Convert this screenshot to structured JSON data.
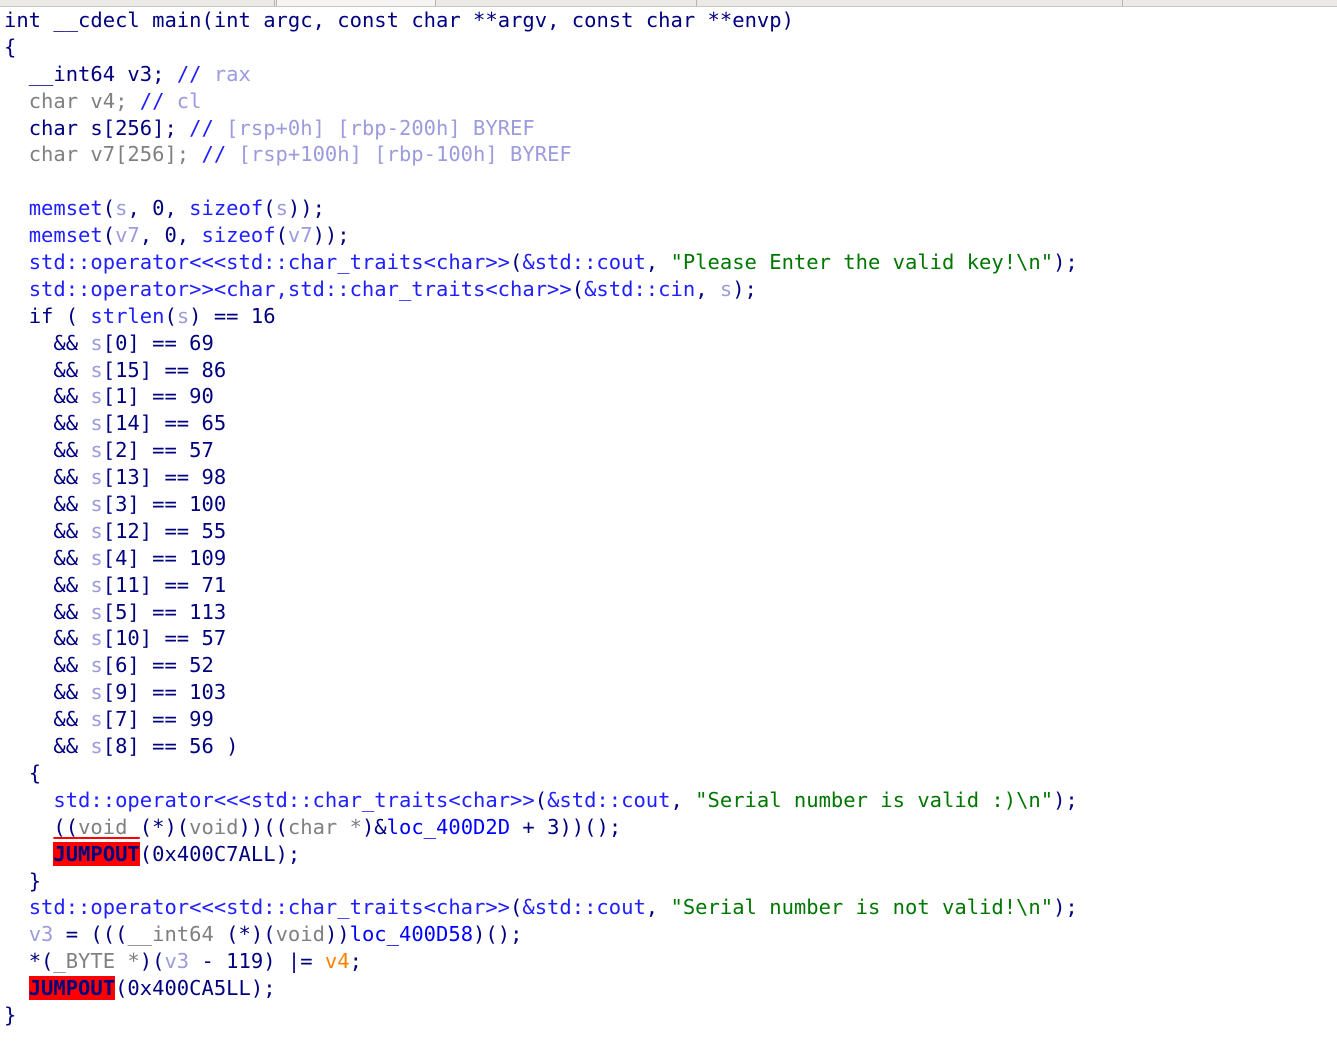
{
  "window": {
    "kind": "hex-rays-pseudocode-view",
    "tab_bar_visible": true
  },
  "code": {
    "language": "c-pseudocode",
    "lines": [
      {
        "id": "l1",
        "indent": 0,
        "text": "int __cdecl main(int argc, const char **argv, const char **envp)"
      },
      {
        "id": "l2",
        "indent": 0,
        "text": "{"
      },
      {
        "id": "l3",
        "indent": 1,
        "text": "__int64 v3; // rax"
      },
      {
        "id": "l4",
        "indent": 1,
        "text": "char v4; // cl"
      },
      {
        "id": "l5",
        "indent": 1,
        "text": "char s[256]; // [rsp+0h] [rbp-200h] BYREF"
      },
      {
        "id": "l6",
        "indent": 1,
        "text": "char v7[256]; // [rsp+100h] [rbp-100h] BYREF"
      },
      {
        "id": "l7",
        "indent": 0,
        "text": ""
      },
      {
        "id": "l8",
        "indent": 1,
        "text": "memset(s, 0, sizeof(s));"
      },
      {
        "id": "l9",
        "indent": 1,
        "text": "memset(v7, 0, sizeof(v7));"
      },
      {
        "id": "l10",
        "indent": 1,
        "text": "std::operator<<<std::char_traits<char>>(&std::cout, \"Please Enter the valid key!\\n\");"
      },
      {
        "id": "l11",
        "indent": 1,
        "text": "std::operator>><char,std::char_traits<char>>(&std::cin, s);"
      },
      {
        "id": "l12",
        "indent": 1,
        "text": "if ( strlen(s) == 16"
      },
      {
        "id": "l13",
        "indent": 2,
        "text": "&& s[0] == 69"
      },
      {
        "id": "l14",
        "indent": 2,
        "text": "&& s[15] == 86"
      },
      {
        "id": "l15",
        "indent": 2,
        "text": "&& s[1] == 90"
      },
      {
        "id": "l16",
        "indent": 2,
        "text": "&& s[14] == 65"
      },
      {
        "id": "l17",
        "indent": 2,
        "text": "&& s[2] == 57"
      },
      {
        "id": "l18",
        "indent": 2,
        "text": "&& s[13] == 98"
      },
      {
        "id": "l19",
        "indent": 2,
        "text": "&& s[3] == 100"
      },
      {
        "id": "l20",
        "indent": 2,
        "text": "&& s[12] == 55"
      },
      {
        "id": "l21",
        "indent": 2,
        "text": "&& s[4] == 109"
      },
      {
        "id": "l22",
        "indent": 2,
        "text": "&& s[11] == 71"
      },
      {
        "id": "l23",
        "indent": 2,
        "text": "&& s[5] == 113"
      },
      {
        "id": "l24",
        "indent": 2,
        "text": "&& s[10] == 57"
      },
      {
        "id": "l25",
        "indent": 2,
        "text": "&& s[6] == 52"
      },
      {
        "id": "l26",
        "indent": 2,
        "text": "&& s[9] == 103"
      },
      {
        "id": "l27",
        "indent": 2,
        "text": "&& s[7] == 99"
      },
      {
        "id": "l28",
        "indent": 2,
        "text": "&& s[8] == 56 )"
      },
      {
        "id": "l29",
        "indent": 1,
        "text": "{"
      },
      {
        "id": "l30",
        "indent": 2,
        "text": "std::operator<<<std::char_traits<char>>(&std::cout, \"Serial number is valid :)\\n\");"
      },
      {
        "id": "l31",
        "indent": 2,
        "text": "((void (*)(void))((char *)&loc_400D2D + 3))();"
      },
      {
        "id": "l32",
        "indent": 2,
        "text": "JUMPOUT(0x400C7ALL);"
      },
      {
        "id": "l33",
        "indent": 1,
        "text": "}"
      },
      {
        "id": "l34",
        "indent": 1,
        "text": "std::operator<<<std::char_traits<char>>(&std::cout, \"Serial number is not valid!\\n\");"
      },
      {
        "id": "l35",
        "indent": 1,
        "text": "v3 = ((__int64 (*)(void))loc_400D58)();"
      },
      {
        "id": "l36",
        "indent": 1,
        "text": "*(_BYTE *)(v3 - 119) |= v4;"
      },
      {
        "id": "l37",
        "indent": 1,
        "text": "JUMPOUT(0x400CA5LL);"
      },
      {
        "id": "l38",
        "indent": 0,
        "text": "}"
      }
    ],
    "signature": {
      "return_type": "int",
      "calling_convention": "__cdecl",
      "name": "main",
      "params": [
        "int argc",
        "const char **argv",
        "const char **envp"
      ]
    },
    "locals": [
      {
        "type": "__int64",
        "name": "v3",
        "comment": "rax"
      },
      {
        "type": "char",
        "name": "v4",
        "comment": "cl"
      },
      {
        "type": "char",
        "name": "s[256]",
        "comment": "[rsp+0h] [rbp-200h] BYREF"
      },
      {
        "type": "char",
        "name": "v7[256]",
        "comment": "[rsp+100h] [rbp-100h] BYREF"
      }
    ],
    "strings": [
      "Please Enter the valid key!\\n",
      "Serial number is valid :)\\n",
      "Serial number is not valid!\\n"
    ],
    "key_checks": {
      "length": 16,
      "constraints": [
        {
          "index": 0,
          "value": 69
        },
        {
          "index": 15,
          "value": 86
        },
        {
          "index": 1,
          "value": 90
        },
        {
          "index": 14,
          "value": 65
        },
        {
          "index": 2,
          "value": 57
        },
        {
          "index": 13,
          "value": 98
        },
        {
          "index": 3,
          "value": 100
        },
        {
          "index": 12,
          "value": 55
        },
        {
          "index": 4,
          "value": 109
        },
        {
          "index": 11,
          "value": 71
        },
        {
          "index": 5,
          "value": 113
        },
        {
          "index": 10,
          "value": 57
        },
        {
          "index": 6,
          "value": 52
        },
        {
          "index": 9,
          "value": 103
        },
        {
          "index": 7,
          "value": 99
        },
        {
          "index": 8,
          "value": 56
        }
      ]
    },
    "jumpouts": [
      "0x400C7ALL",
      "0x400CA5LL"
    ],
    "labels": [
      "loc_400D2D",
      "loc_400D58"
    ]
  },
  "tokens": {
    "l1": [
      {
        "t": "int",
        "c": "kw"
      },
      {
        "t": " ",
        "c": "kw"
      },
      {
        "t": "__cdecl",
        "c": "kw"
      },
      {
        "t": " ",
        "c": "kw"
      },
      {
        "t": "main",
        "c": "kw"
      },
      {
        "t": "(",
        "c": "kw"
      },
      {
        "t": "int",
        "c": "kw"
      },
      {
        "t": " argc, ",
        "c": "kw"
      },
      {
        "t": "const char **argv, const char **envp)",
        "c": "kw"
      }
    ],
    "l3": [
      {
        "t": "__int64",
        "c": "kw"
      },
      {
        "t": " v3; ",
        "c": "kw"
      },
      {
        "t": "//",
        "c": "cmtslash"
      },
      {
        "t": " rax",
        "c": "cmt"
      }
    ],
    "l4": [
      {
        "t": "char",
        "c": "kwg"
      },
      {
        "t": " v4; ",
        "c": "kwg"
      },
      {
        "t": "//",
        "c": "cmtslash"
      },
      {
        "t": " cl",
        "c": "cmt"
      }
    ],
    "l5": [
      {
        "t": "char",
        "c": "kw"
      },
      {
        "t": " s[256]; ",
        "c": "kw"
      },
      {
        "t": "//",
        "c": "cmtslash"
      },
      {
        "t": " [rsp+0h] [rbp-200h] BYREF",
        "c": "cmt"
      }
    ],
    "l6": [
      {
        "t": "char",
        "c": "kwg"
      },
      {
        "t": " v7[256]; ",
        "c": "kwg"
      },
      {
        "t": "//",
        "c": "cmtslash"
      },
      {
        "t": " [rsp+100h] [rbp-100h] BYREF",
        "c": "cmt"
      }
    ],
    "l8": [
      {
        "t": "memset",
        "c": "fn"
      },
      {
        "t": "(",
        "c": "kw"
      },
      {
        "t": "s",
        "c": "var"
      },
      {
        "t": ", 0, ",
        "c": "kw"
      },
      {
        "t": "sizeof",
        "c": "fn"
      },
      {
        "t": "(",
        "c": "kw"
      },
      {
        "t": "s",
        "c": "var"
      },
      {
        "t": "));",
        "c": "kw"
      }
    ],
    "l9": [
      {
        "t": "memset",
        "c": "fn"
      },
      {
        "t": "(",
        "c": "kw"
      },
      {
        "t": "v7",
        "c": "var"
      },
      {
        "t": ", 0, ",
        "c": "kw"
      },
      {
        "t": "sizeof",
        "c": "fn"
      },
      {
        "t": "(",
        "c": "kw"
      },
      {
        "t": "v7",
        "c": "var"
      },
      {
        "t": "));",
        "c": "kw"
      }
    ],
    "l10": [
      {
        "t": "std::operator<<<std::char_traits<char>>",
        "c": "fn"
      },
      {
        "t": "(",
        "c": "kw"
      },
      {
        "t": "&std::cout",
        "c": "fn"
      },
      {
        "t": ", ",
        "c": "kw"
      },
      {
        "t": "\"Please Enter the valid key!\\n\"",
        "c": "str"
      },
      {
        "t": ");",
        "c": "kw"
      }
    ],
    "l11": [
      {
        "t": "std::operator>><char,std::char_traits<char>>",
        "c": "fn"
      },
      {
        "t": "(",
        "c": "kw"
      },
      {
        "t": "&std::cin",
        "c": "fn"
      },
      {
        "t": ", ",
        "c": "kw"
      },
      {
        "t": "s",
        "c": "var"
      },
      {
        "t": ");",
        "c": "kw"
      }
    ],
    "l12": [
      {
        "t": "if",
        "c": "kw"
      },
      {
        "t": " ( ",
        "c": "kw"
      },
      {
        "t": "strlen",
        "c": "fn"
      },
      {
        "t": "(",
        "c": "kw"
      },
      {
        "t": "s",
        "c": "var"
      },
      {
        "t": ") == 16",
        "c": "kw"
      }
    ],
    "l30": [
      {
        "t": "std::operator<<<std::char_traits<char>>",
        "c": "fn"
      },
      {
        "t": "(",
        "c": "kw"
      },
      {
        "t": "&std::cout",
        "c": "fn"
      },
      {
        "t": ", ",
        "c": "kw"
      },
      {
        "t": "\"Serial number is valid :)\\n\"",
        "c": "str"
      },
      {
        "t": ");",
        "c": "kw"
      }
    ],
    "l31": [
      {
        "t": "((",
        "c": "kw"
      },
      {
        "t": "void",
        "c": "kwg"
      },
      {
        "t": " ",
        "c": "kwg"
      },
      {
        "t": "(*)(",
        "c": "kw"
      },
      {
        "t": "void",
        "c": "kwg"
      },
      {
        "t": "))((",
        "c": "kw"
      },
      {
        "t": "char",
        "c": "kwg"
      },
      {
        "t": " *",
        "c": "kwg"
      },
      {
        "t": ")&",
        "c": "kw"
      },
      {
        "t": "loc_400D2D",
        "c": "loc"
      },
      {
        "t": " + 3))();",
        "c": "kw"
      }
    ],
    "l32": [
      {
        "t": "JUMPOUT",
        "c": "jump"
      },
      {
        "t": "(0x400C7ALL);",
        "c": "kw"
      }
    ],
    "l34": [
      {
        "t": "std::operator<<<std::char_traits<char>>",
        "c": "fn"
      },
      {
        "t": "(",
        "c": "kw"
      },
      {
        "t": "&std::cout",
        "c": "fn"
      },
      {
        "t": ", ",
        "c": "kw"
      },
      {
        "t": "\"Serial number is not valid!\\n\"",
        "c": "str"
      },
      {
        "t": ");",
        "c": "kw"
      }
    ],
    "l35": [
      {
        "t": "v3",
        "c": "var"
      },
      {
        "t": " = (((",
        "c": "kw"
      },
      {
        "t": "__int64",
        "c": "kwg"
      },
      {
        "t": " (*)(",
        "c": "kw"
      },
      {
        "t": "void",
        "c": "kwg"
      },
      {
        "t": "))",
        "c": "kw"
      },
      {
        "t": "loc_400D58",
        "c": "loc"
      },
      {
        "t": ")();",
        "c": "kw"
      }
    ],
    "l36": [
      {
        "t": "*(",
        "c": "kw"
      },
      {
        "t": "_BYTE",
        "c": "kwg"
      },
      {
        "t": " *",
        "c": "kwg"
      },
      {
        "t": ")(",
        "c": "kw"
      },
      {
        "t": "v3",
        "c": "var"
      },
      {
        "t": " - 119) |= ",
        "c": "kw"
      },
      {
        "t": "v4",
        "c": "varhl"
      },
      {
        "t": ";",
        "c": "kw"
      }
    ],
    "l37": [
      {
        "t": "JUMPOUT",
        "c": "jump"
      },
      {
        "t": "(0x400CA5LL);",
        "c": "kw"
      }
    ]
  },
  "colors": {
    "background": "#ffffff",
    "keyword": "#00007f",
    "greyed_keyword": "#808080",
    "function": "#2020ff",
    "variable": "#9b9bdd",
    "highlighted_variable": "#ff8000",
    "string": "#007700",
    "comment": "#9b9bdd",
    "location_label": "#0000ff",
    "jumpout_background": "#ff0000",
    "tabstrip": "#eceae6"
  }
}
